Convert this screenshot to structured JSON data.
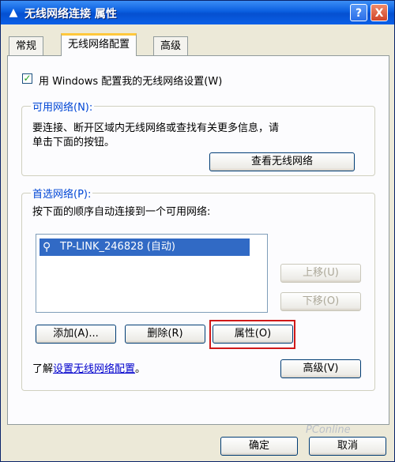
{
  "window": {
    "title": "无线网络连接 属性",
    "help_label": "?",
    "close_label": "X"
  },
  "tabs": [
    {
      "label": "常规"
    },
    {
      "label": "无线网络配置"
    },
    {
      "label": "高级"
    }
  ],
  "wireless_config": {
    "use_windows_label": "用 Windows 配置我的无线网络设置(W)",
    "use_windows_checked": true,
    "available": {
      "title": "可用网络(N):",
      "description_line1": "要连接、断开区域内无线网络或查找有关更多信息，请",
      "description_line2": "单击下面的按钮。",
      "view_button": "查看无线网络"
    },
    "preferred": {
      "title": "首选网络(P):",
      "description": "按下面的顺序自动连接到一个可用网络:",
      "networks": [
        {
          "name": "TP-LINK_246828 (自动)",
          "selected": true
        }
      ],
      "move_up_button": "上移(U)",
      "move_down_button": "下移(O)",
      "add_button": "添加(A)...",
      "remove_button": "删除(R)",
      "properties_button": "属性(O)"
    },
    "learn_prefix": "了解",
    "learn_link": "设置无线网络配置",
    "learn_suffix": "。",
    "advanced_button": "高级(V)"
  },
  "footer": {
    "ok_button": "确定",
    "cancel_button": "取消"
  },
  "watermark": "PConline"
}
